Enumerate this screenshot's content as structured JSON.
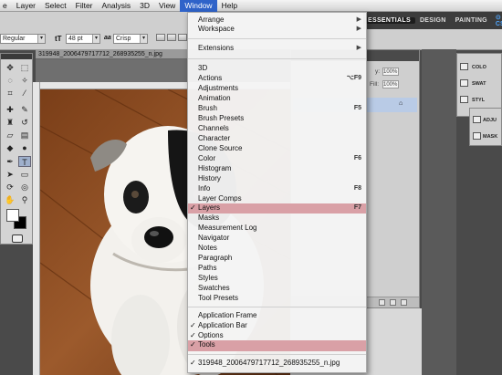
{
  "menubar": {
    "items": [
      "e",
      "Layer",
      "Select",
      "Filter",
      "Analysis",
      "3D",
      "View",
      "Window",
      "Help"
    ],
    "active_index": 7
  },
  "options_bar": {
    "font_style": "Regular",
    "font_size": "48 pt",
    "antialias_icon": "aa",
    "antialias": "Crisp"
  },
  "workspace": {
    "buttons": [
      "ESSENTIALS",
      "DESIGN",
      "PAINTING"
    ],
    "selected_index": 0,
    "cs_live": "CS"
  },
  "document": {
    "tab_title": "319948_2006479717712_268935255_n.jpg"
  },
  "layers_panel": {
    "opacity_label": "y:",
    "opacity_value": "100%",
    "fill_label": "Fill:",
    "fill_value": "100%"
  },
  "right_panels": {
    "items": [
      "COLO",
      "SWAT",
      "STYL",
      "ADJU",
      "MASK"
    ]
  },
  "window_menu": {
    "items": [
      {
        "label": "Arrange",
        "submenu": true
      },
      {
        "label": "Workspace",
        "submenu": true
      },
      {
        "label": "Extensions",
        "submenu": true
      },
      {
        "label": "3D"
      },
      {
        "label": "Actions",
        "shortcut": "⌥F9"
      },
      {
        "label": "Adjustments"
      },
      {
        "label": "Animation"
      },
      {
        "label": "Brush",
        "shortcut": "F5"
      },
      {
        "label": "Brush Presets"
      },
      {
        "label": "Channels"
      },
      {
        "label": "Character"
      },
      {
        "label": "Clone Source"
      },
      {
        "label": "Color",
        "shortcut": "F6"
      },
      {
        "label": "Histogram"
      },
      {
        "label": "History"
      },
      {
        "label": "Info",
        "shortcut": "F8"
      },
      {
        "label": "Layer Comps"
      },
      {
        "label": "Layers",
        "shortcut": "F7",
        "checked": true,
        "highlighted": true
      },
      {
        "label": "Masks"
      },
      {
        "label": "Measurement Log"
      },
      {
        "label": "Navigator"
      },
      {
        "label": "Notes"
      },
      {
        "label": "Paragraph"
      },
      {
        "label": "Paths"
      },
      {
        "label": "Styles"
      },
      {
        "label": "Swatches"
      },
      {
        "label": "Tool Presets"
      },
      {
        "label": "Application Frame"
      },
      {
        "label": "Application Bar",
        "checked": true
      },
      {
        "label": "Options",
        "checked": true
      },
      {
        "label": "Tools",
        "checked": true,
        "highlighted": true
      },
      {
        "label": "319948_2006479717712_268935255_n.jpg",
        "checked": true
      }
    ],
    "submenu_glyph": "▶",
    "check_glyph": "✓"
  },
  "colors": {
    "menu_highlight": "#d9a0a6",
    "menubar_active": "#2f63c9",
    "selection_blue": "#b9cbe6"
  }
}
